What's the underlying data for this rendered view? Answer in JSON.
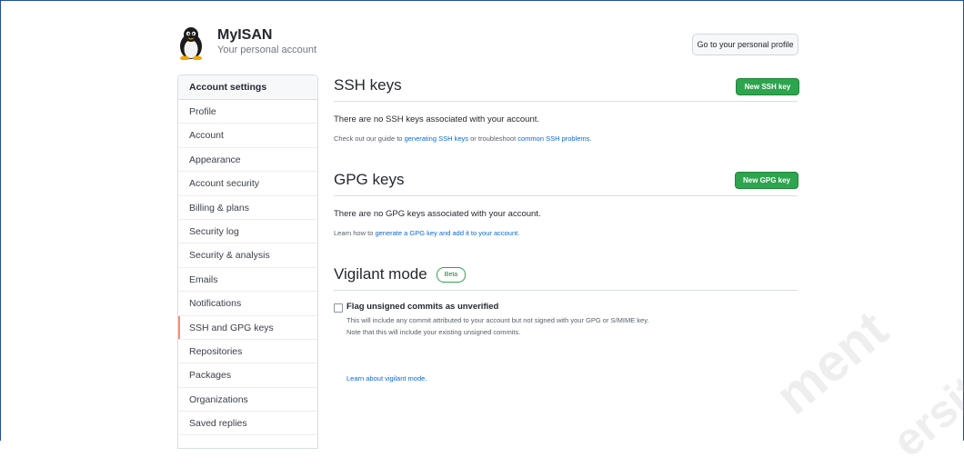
{
  "header": {
    "account_name": "MyISAN",
    "account_subtitle": "Your personal account",
    "profile_button": "Go to your personal profile"
  },
  "sidebar": {
    "heading": "Account settings",
    "selected": "SSH and GPG keys",
    "items": [
      {
        "label": "Profile"
      },
      {
        "label": "Account"
      },
      {
        "label": "Appearance"
      },
      {
        "label": "Account security"
      },
      {
        "label": "Billing & plans"
      },
      {
        "label": "Security log"
      },
      {
        "label": "Security & analysis"
      },
      {
        "label": "Emails"
      },
      {
        "label": "Notifications"
      },
      {
        "label": "SSH and GPG keys"
      },
      {
        "label": "Repositories"
      },
      {
        "label": "Packages"
      },
      {
        "label": "Organizations"
      },
      {
        "label": "Saved replies"
      }
    ]
  },
  "ssh": {
    "title": "SSH keys",
    "new_button": "New SSH key",
    "empty_message": "There are no SSH keys associated with your account.",
    "hint_prefix": "Check out our guide to ",
    "hint_link1": "generating SSH keys",
    "hint_middle": " or troubleshoot ",
    "hint_link2": "common SSH problems",
    "hint_suffix": "."
  },
  "gpg": {
    "title": "GPG keys",
    "new_button": "New GPG key",
    "empty_message": "There are no GPG keys associated with your account.",
    "hint_prefix": "Learn how to ",
    "hint_link": "generate a GPG key and add it to your account",
    "hint_suffix": "."
  },
  "vigilant": {
    "title": "Vigilant mode",
    "badge": "Beta",
    "checkbox_label": "Flag unsigned commits as unverified",
    "checked": false,
    "note_line1": "This will include any commit attributed to your account but not signed with your GPG or S/MIME key.",
    "note_line2": "Note that this will include your existing unsigned commits.",
    "learn_link": "Learn about vigilant mode."
  },
  "watermark": {
    "word1": "ment",
    "word2": "ersit"
  },
  "colors": {
    "accent_green": "#2da44e",
    "link_blue": "#0969da",
    "selected_marker": "#fd8c73",
    "frame_border": "#1f4e99"
  }
}
